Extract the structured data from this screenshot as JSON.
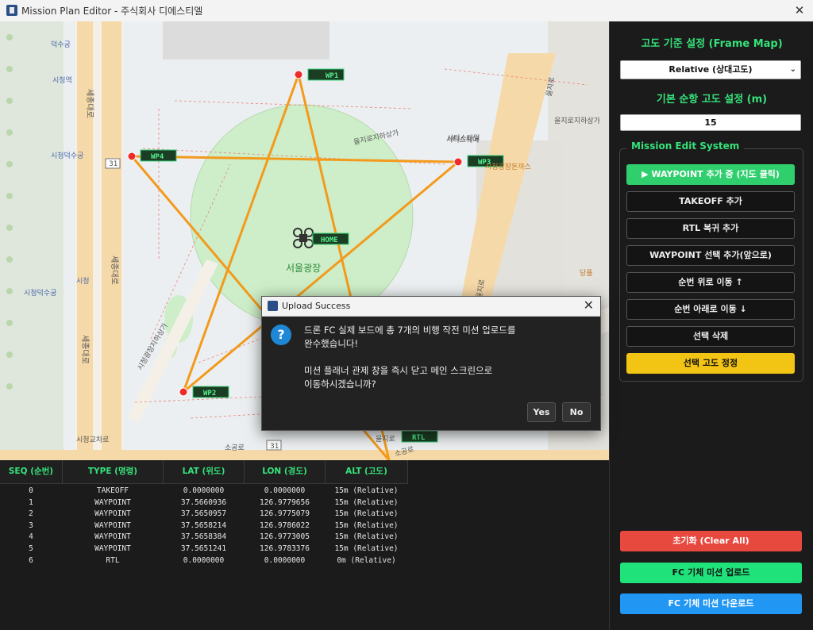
{
  "window": {
    "title": "Mission Plan Editor - 주식회사 디에스티엘"
  },
  "map": {
    "place_label": "서울광장",
    "markers": {
      "wp1": "WP1",
      "wp2": "WP2",
      "wp3": "WP3",
      "wp4": "WP4",
      "home": "HOME",
      "rtl": "RTL"
    },
    "labels": {
      "sejong_ro": "세종대로",
      "sejong_ro_2": "세종대로",
      "sejong_ro_3": "세종대로",
      "euljiro_mall": "을지로지하상가",
      "euljiro_mall_2": "을지로지하상가",
      "euljiro": "을지로",
      "euljiro_2": "을지로",
      "euljiro_3": "을지로",
      "city_hall_mall": "시청광장지하상가",
      "city_hall_mall_2": "시티스퀘어",
      "sogong_ro": "소공로",
      "sogong_ro_2": "소공로",
      "deoksugung": "덕수궁",
      "city_hall_station": "시청역",
      "city_hall_lbl": "시청",
      "deoksugung_lbl": "시청덕수궁",
      "deoksugung_ent": "시청덕수궁",
      "shinhan": "시티스타일",
      "donkatsu": "시청광장돈까스",
      "restaurant": "당플",
      "road31": "31",
      "road31b": "31",
      "sigongo": "시청교차로"
    }
  },
  "right": {
    "alt_ref_title": "고도 기준 설정 (Frame Map)",
    "alt_ref_value": "Relative (상대고도)",
    "cruise_title": "기본 순항 고도 설정 (m)",
    "cruise_value": "15",
    "group_title": "Mission Edit System",
    "buttons": {
      "add_wp": "▶ WAYPOINT 추가 중 (지도 클릭)",
      "takeoff": "TAKEOFF 추가",
      "rtl": "RTL 복귀 추가",
      "insert_wp": "WAYPOINT 선택 추가(앞으로)",
      "move_up": "순번 위로 이동 ↑",
      "move_down": "순번 아래로 이동 ↓",
      "delete": "선택 삭제",
      "alt_fix": "선택 고도 정정"
    },
    "clear": "초기화 (Clear All)",
    "upload": "FC 기체 미션 업로드",
    "download": "FC 기체 미션 다운로드"
  },
  "table": {
    "headers": [
      "SEQ (순번)",
      "TYPE (명령)",
      "LAT (위도)",
      "LON (경도)",
      "ALT (고도)"
    ],
    "rows": [
      [
        "0",
        "TAKEOFF",
        "0.0000000",
        "0.0000000",
        "15m (Relative)"
      ],
      [
        "1",
        "WAYPOINT",
        "37.5660936",
        "126.9779656",
        "15m (Relative)"
      ],
      [
        "2",
        "WAYPOINT",
        "37.5650957",
        "126.9775079",
        "15m (Relative)"
      ],
      [
        "3",
        "WAYPOINT",
        "37.5658214",
        "126.9786022",
        "15m (Relative)"
      ],
      [
        "4",
        "WAYPOINT",
        "37.5658384",
        "126.9773005",
        "15m (Relative)"
      ],
      [
        "5",
        "WAYPOINT",
        "37.5651241",
        "126.9783376",
        "15m (Relative)"
      ],
      [
        "6",
        "RTL",
        "0.0000000",
        "0.0000000",
        "0m (Relative)"
      ]
    ]
  },
  "dialog": {
    "title": "Upload Success",
    "message": "드론 FC 실제 보드에 총 7개의 비행 작전 미션 업로드를\n완수했습니다!\n\n미션 플래너 관제 창을 즉시 닫고 메인 스크린으로\n이동하시겠습니까?",
    "yes": "Yes",
    "no": "No"
  },
  "colors": {
    "accent_green": "#35e27a",
    "clear_red": "#e8493f",
    "upload_green": "#1fe37a",
    "download_blue": "#2196f3",
    "path_orange": "#f39a1c"
  }
}
